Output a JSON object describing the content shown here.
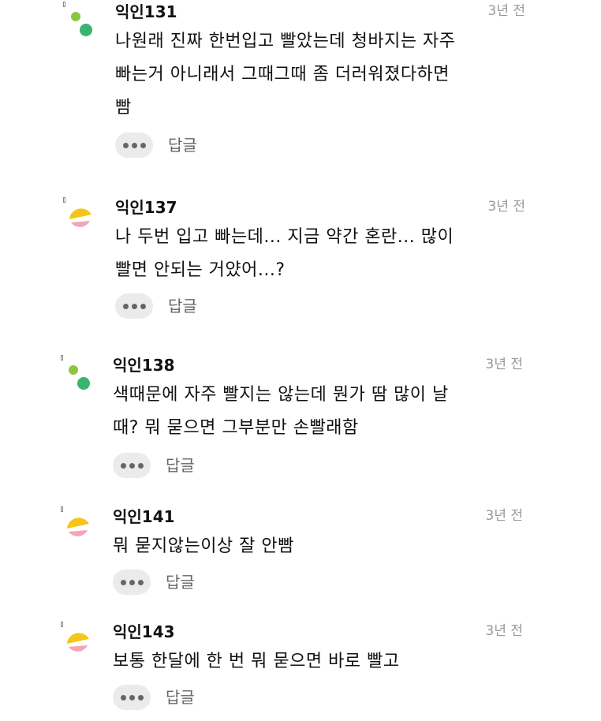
{
  "comments": [
    {
      "nickname": "익인131",
      "time": "3년 전",
      "avatar_icon": "green-dots-avatar-icon",
      "lines": [
        "나원래 진짜 한번입고 빨았는데 청바지는 자주",
        "빠는거 아니래서 그때그때 좀 더러워졌다하면",
        "빰"
      ],
      "reply_label": "답글"
    },
    {
      "nickname": "익인137",
      "time": "3년 전",
      "avatar_icon": "yellow-pink-avatar-icon",
      "lines": [
        "나 두번 입고 빠는데... 지금 약간 혼란... 많이",
        "빨면 안되는 거얐어...?"
      ],
      "reply_label": "답글"
    },
    {
      "nickname": "익인138",
      "time": "3년 전",
      "avatar_icon": "green-dots-avatar-icon",
      "lines": [
        "색때문에 자주 빨지는 않는데 뭔가 땀 많이 날",
        "때? 뭐 묻으면 그부분만 손빨래함"
      ],
      "reply_label": "답글"
    },
    {
      "nickname": "익인141",
      "time": "3년 전",
      "avatar_icon": "yellow-pink-avatar-icon",
      "lines": [
        "뭐 묻지않는이상 잘 안빰"
      ],
      "reply_label": "답글"
    },
    {
      "nickname": "익인143",
      "time": "3년 전",
      "avatar_icon": "yellow-pink-avatar-icon",
      "lines": [
        "보통 한달에 한 번 뭐 묻으면 바로 빨고"
      ],
      "reply_label": "답글"
    }
  ],
  "colors": {
    "green_light": "#8cc63f",
    "green_dark": "#3cb371",
    "yellow": "#f5c518",
    "pink": "#f2a7b8",
    "time_gray": "#999999",
    "button_bg": "#ebebeb"
  }
}
